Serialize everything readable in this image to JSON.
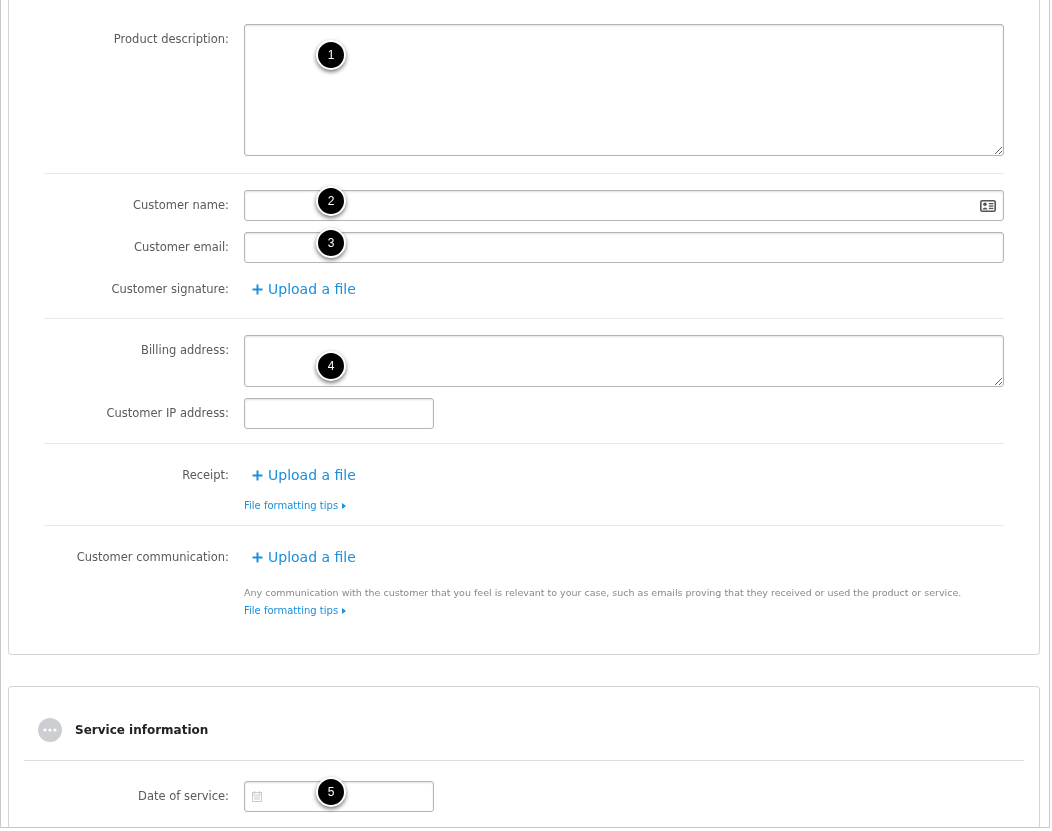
{
  "form_card": {
    "groups": [
      {
        "fields": [
          {
            "kind": "textarea",
            "label": "Product description:",
            "callout": "1"
          }
        ]
      },
      {
        "fields": [
          {
            "kind": "contact",
            "label": "Customer name:",
            "callout": "2"
          },
          {
            "kind": "text",
            "label": "Customer email:",
            "callout": "3"
          },
          {
            "kind": "upload",
            "label": "Customer signature:",
            "action": "Upload a file"
          }
        ]
      },
      {
        "fields": [
          {
            "kind": "short_textarea",
            "label": "Billing address:",
            "callout": "4"
          },
          {
            "kind": "short",
            "label": "Customer IP address:"
          }
        ]
      },
      {
        "fields": [
          {
            "kind": "upload",
            "label": "Receipt:",
            "action": "Upload a file",
            "tips_link": "File formatting tips"
          }
        ]
      },
      {
        "fields": [
          {
            "kind": "upload",
            "label": "Customer communication:",
            "action": "Upload a file",
            "help": "Any communication with the customer that you feel is relevant to your case, such as emails proving that they received or used the product or service.",
            "help_link": "File formatting tips"
          }
        ]
      }
    ]
  },
  "service_card": {
    "title": "Service information",
    "fields": [
      {
        "kind": "date",
        "label": "Date of service:",
        "callout": "5"
      }
    ]
  }
}
